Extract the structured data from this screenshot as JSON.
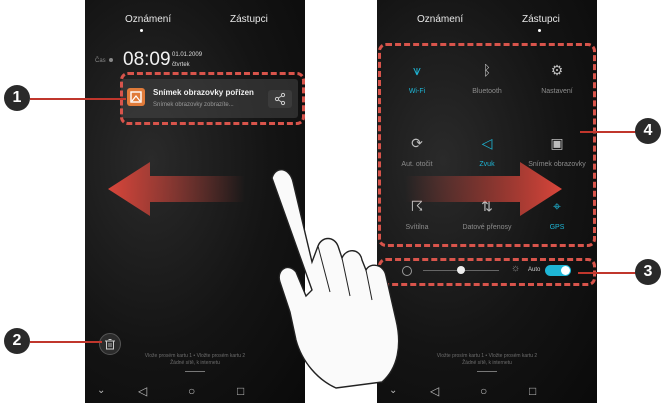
{
  "colors": {
    "accent": "#1eb6d6",
    "callout_red": "#c0362c",
    "arrow_red": "#d9463b"
  },
  "left_phone": {
    "tabs": [
      "Oznámení",
      "Zástupci"
    ],
    "time_prefix": "Čas",
    "time": "08:09",
    "date": "01.01.2009",
    "weekday": "čtvrtek",
    "notification": {
      "title": "Snímek obrazovky pořízen",
      "subtitle": "Snímek obrazovky zobrazíte...",
      "icon": "image-icon",
      "action_icon": "share-icon"
    },
    "hint_line1": "Vlože prosém kartu 1 • Vložte prosém kartu 2",
    "hint_line2": "Žádné sítě, k internetu",
    "delete_icon": "trash-icon"
  },
  "right_phone": {
    "tabs": [
      "Oznámení",
      "Zástupci"
    ],
    "tiles": [
      {
        "label": "Wi-Fi",
        "icon": "wifi-icon",
        "active": true
      },
      {
        "label": "Bluetooth",
        "icon": "bluetooth-icon",
        "active": false
      },
      {
        "label": "Nastavení",
        "icon": "settings-icon",
        "active": false
      },
      {
        "label": "Aut. otočit",
        "icon": "rotate-icon",
        "active": false
      },
      {
        "label": "Zvuk",
        "icon": "sound-icon",
        "active": true
      },
      {
        "label": "Snímek obrazovky",
        "icon": "screenshot-icon",
        "active": false
      },
      {
        "label": "Svítilna",
        "icon": "flashlight-icon",
        "active": false
      },
      {
        "label": "Datové přenosy",
        "icon": "data-icon",
        "active": false
      },
      {
        "label": "GPS",
        "icon": "location-icon",
        "active": true
      }
    ],
    "brightness": {
      "auto_label": "Auto",
      "auto_on": true,
      "level": 0.5
    },
    "hint_line1": "Vložte prosím kartu 1 • Vložte prosém kartu 2",
    "hint_line2": "Žádné sítě, k internetu"
  },
  "callouts": [
    "1",
    "2",
    "3",
    "4"
  ]
}
